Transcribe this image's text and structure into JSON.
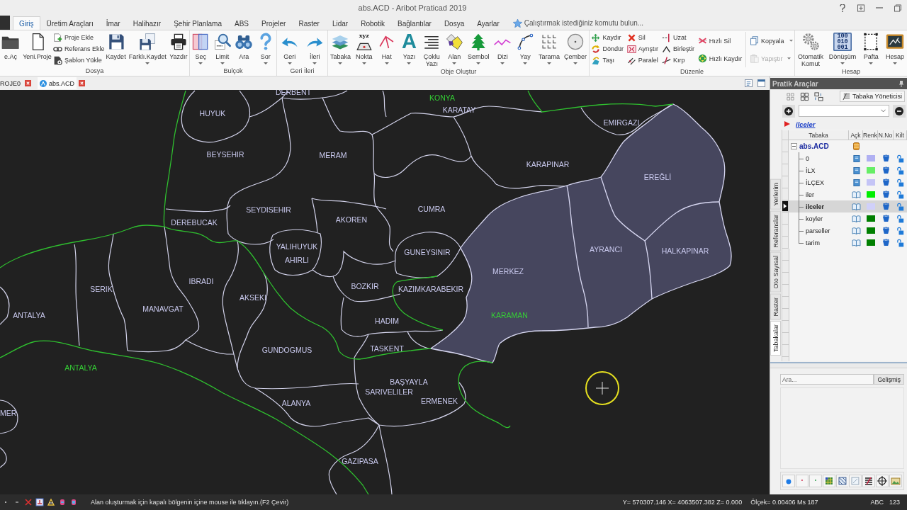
{
  "window": {
    "title": "abs.ACD - Aribot Praticad 2019"
  },
  "menu_tabs": [
    {
      "label": "Giriş",
      "selected": true
    },
    {
      "label": "Üretim Araçları",
      "selected": false
    },
    {
      "label": "İmar",
      "selected": false
    },
    {
      "label": "Halihazır",
      "selected": false
    },
    {
      "label": "Şehir Planlama",
      "selected": false
    },
    {
      "label": "ABS",
      "selected": false
    },
    {
      "label": "Projeler",
      "selected": false
    },
    {
      "label": "Raster",
      "selected": false
    },
    {
      "label": "Lidar",
      "selected": false
    },
    {
      "label": "Robotik",
      "selected": false
    },
    {
      "label": "Bağlantılar",
      "selected": false
    },
    {
      "label": "Dosya",
      "selected": false
    },
    {
      "label": "Ayarlar",
      "selected": false
    }
  ],
  "command_search": {
    "placeholder": "Çalıştırmak istediğiniz komutu bulun..."
  },
  "ribbon": {
    "groups": [
      {
        "label": "Dosya",
        "items": [
          {
            "kind": "large",
            "label": "e.Aç",
            "dropdown": false
          },
          {
            "kind": "large",
            "label": "Yeni.Proje",
            "dropdown": false
          },
          {
            "kind": "stack",
            "entries": [
              {
                "label": "Proje Ekle",
                "dropdown": false,
                "disabled": false
              },
              {
                "label": "Referans Ekle",
                "dropdown": false,
                "disabled": false
              },
              {
                "label": "Şablon Yükle",
                "dropdown": false,
                "disabled": false
              }
            ]
          },
          {
            "kind": "large",
            "label": "Kaydet",
            "dropdown": false
          },
          {
            "kind": "large",
            "label": "Farklı.Kaydet",
            "dropdown": true
          },
          {
            "kind": "large",
            "label": "Yazdır",
            "dropdown": false
          }
        ]
      },
      {
        "label": "Bulçok",
        "items": [
          {
            "kind": "large",
            "label": "Seç",
            "dropdown": true
          },
          {
            "kind": "large",
            "label": "Limit",
            "dropdown": true
          },
          {
            "kind": "large",
            "label": "Ara",
            "dropdown": false
          },
          {
            "kind": "large",
            "label": "Sor",
            "dropdown": true
          }
        ]
      },
      {
        "label": "Geri İleri",
        "items": [
          {
            "kind": "large",
            "label": "Geri",
            "dropdown": true
          },
          {
            "kind": "large",
            "label": "İleri",
            "dropdown": true
          }
        ]
      },
      {
        "label": "Obje Oluştur",
        "items": [
          {
            "kind": "large",
            "label": "Tabaka",
            "dropdown": true
          },
          {
            "kind": "large",
            "label": "Nokta",
            "dropdown": true,
            "icon_text": "xyz"
          },
          {
            "kind": "large",
            "label": "Hat",
            "dropdown": true
          },
          {
            "kind": "large",
            "label": "Yazı",
            "dropdown": true,
            "icon_text": "A"
          },
          {
            "kind": "large",
            "label": "Çoklu Yazı",
            "dropdown": false
          },
          {
            "kind": "large",
            "label": "Alan",
            "dropdown": true
          },
          {
            "kind": "large",
            "label": "Sembol",
            "dropdown": true
          },
          {
            "kind": "large",
            "label": "Dizi",
            "dropdown": true
          },
          {
            "kind": "large",
            "label": "Yay",
            "dropdown": true
          },
          {
            "kind": "large",
            "label": "Tarama",
            "dropdown": true
          },
          {
            "kind": "large",
            "label": "Çember",
            "dropdown": true
          }
        ]
      },
      {
        "label": "Düzenle",
        "items": [
          {
            "kind": "stack",
            "entries": [
              {
                "label": "Kaydır",
                "dropdown": false,
                "disabled": false
              },
              {
                "label": "Döndür",
                "dropdown": false,
                "disabled": false
              },
              {
                "label": "Taşı",
                "dropdown": false,
                "disabled": false
              }
            ]
          },
          {
            "kind": "stack",
            "entries": [
              {
                "label": "Sil",
                "dropdown": false,
                "disabled": false
              },
              {
                "label": "Ayrıştır",
                "dropdown": false,
                "disabled": false
              },
              {
                "label": "Paralel",
                "dropdown": false,
                "disabled": false
              }
            ]
          },
          {
            "kind": "stack",
            "entries": [
              {
                "label": "Uzat",
                "dropdown": false,
                "disabled": false
              },
              {
                "label": "Birleştir",
                "dropdown": false,
                "disabled": false
              },
              {
                "label": "Kırp",
                "dropdown": false,
                "disabled": false
              }
            ]
          },
          {
            "kind": "stack",
            "entries": [
              {
                "label": "Hızlı Sil",
                "dropdown": false,
                "disabled": false
              },
              {
                "label": "Hızlı Kaydır",
                "dropdown": false,
                "disabled": false
              }
            ]
          },
          {
            "kind": "stack",
            "entries": [
              {
                "label": "Kopyala",
                "dropdown": true,
                "disabled": false
              },
              {
                "label": "Yapıştır",
                "dropdown": true,
                "disabled": true
              }
            ]
          }
        ]
      },
      {
        "label": "Hesap",
        "items": [
          {
            "kind": "large",
            "label": "Otomatik Komut",
            "dropdown": false
          },
          {
            "kind": "large",
            "label": "Dönüşüm",
            "dropdown": true,
            "icon_text": "100 010 001"
          },
          {
            "kind": "large",
            "label": "Pafta",
            "dropdown": true
          },
          {
            "kind": "large",
            "label": "Hesap",
            "dropdown": true
          }
        ]
      }
    ]
  },
  "document_tabs": [
    {
      "label": "ROJE0",
      "selected": false
    },
    {
      "label": "abs.ACD",
      "selected": true
    }
  ],
  "map": {
    "labels": [
      {
        "text": "DERBENT",
        "kind": "district"
      },
      {
        "text": "KONYA",
        "kind": "province"
      },
      {
        "text": "KARATAY",
        "kind": "district"
      },
      {
        "text": "HUYUK",
        "kind": "district"
      },
      {
        "text": "EMIRGAZI",
        "kind": "district"
      },
      {
        "text": "BEYSEHIR",
        "kind": "district"
      },
      {
        "text": "MERAM",
        "kind": "district"
      },
      {
        "text": "KARAPINAR",
        "kind": "district"
      },
      {
        "text": "EREĞLİ",
        "kind": "district"
      },
      {
        "text": "SEYDISEHIR",
        "kind": "district"
      },
      {
        "text": "CUMRA",
        "kind": "district"
      },
      {
        "text": "DEREBUCAK",
        "kind": "district"
      },
      {
        "text": "AKOREN",
        "kind": "district"
      },
      {
        "text": "YALIHUYUK",
        "kind": "district"
      },
      {
        "text": "AHIRLI",
        "kind": "district"
      },
      {
        "text": "GUNEYSINIR",
        "kind": "district"
      },
      {
        "text": "AYRANCI",
        "kind": "district"
      },
      {
        "text": "HALKAPINAR",
        "kind": "district"
      },
      {
        "text": "MERKEZ",
        "kind": "district"
      },
      {
        "text": "IBRADI",
        "kind": "district"
      },
      {
        "text": "SERIK",
        "kind": "district"
      },
      {
        "text": "BOZKIR",
        "kind": "district"
      },
      {
        "text": "KAZIMKARABEKIR",
        "kind": "district"
      },
      {
        "text": "AKSEKI",
        "kind": "district"
      },
      {
        "text": "MANAVGAT",
        "kind": "district"
      },
      {
        "text": "ANTALYA",
        "kind": "district"
      },
      {
        "text": "KARAMAN",
        "kind": "province"
      },
      {
        "text": "HADIM",
        "kind": "district"
      },
      {
        "text": "TASKENT",
        "kind": "district"
      },
      {
        "text": "GUNDOGMUS",
        "kind": "district"
      },
      {
        "text": "ANTALYA",
        "kind": "province"
      },
      {
        "text": "BAŞYAYLA",
        "kind": "district"
      },
      {
        "text": "SARIVELILER",
        "kind": "district"
      },
      {
        "text": "ERMENEK",
        "kind": "district"
      },
      {
        "text": "ALANYA",
        "kind": "district"
      },
      {
        "text": "GAZIPASA",
        "kind": "district"
      },
      {
        "text": "MER",
        "kind": "district"
      }
    ]
  },
  "side_panel": {
    "title": "Pratik Araçlar",
    "manager_button": "Tabaka Yöneticisi",
    "current_layer": "ilceler",
    "layer_table": {
      "columns": [
        "Tabaka",
        "Açk",
        "Renk",
        "N.No",
        "Kilt"
      ],
      "root": {
        "name": "abs.ACD",
        "expanded": true,
        "children": [
          {
            "name": "0",
            "open": false,
            "color": "#b0b0f2",
            "locked": false,
            "selected": false
          },
          {
            "name": "İLX",
            "open": false,
            "color": "#66ee66",
            "locked": false,
            "selected": false
          },
          {
            "name": "İLÇEX",
            "open": false,
            "color": "#c4c4f6",
            "locked": false,
            "selected": false
          },
          {
            "name": "iler",
            "open": true,
            "color": "#00ee00",
            "locked": false,
            "selected": false
          },
          {
            "name": "ilceler",
            "open": true,
            "color": "#d0d0fa",
            "locked": false,
            "selected": true
          },
          {
            "name": "koyler",
            "open": true,
            "color": "#007f00",
            "locked": false,
            "selected": false
          },
          {
            "name": "parseller",
            "open": true,
            "color": "#007f00",
            "locked": false,
            "selected": false
          },
          {
            "name": "tarim",
            "open": true,
            "color": "#007f00",
            "locked": false,
            "selected": false
          }
        ]
      }
    },
    "vertical_tabs": [
      {
        "label": "Yerlerim",
        "selected": false
      },
      {
        "label": "Referanslar",
        "selected": false
      },
      {
        "label": "Oto Sayısal",
        "selected": false
      },
      {
        "label": "Raster",
        "selected": false
      },
      {
        "label": "Tabakalar",
        "selected": true
      }
    ],
    "search": {
      "placeholder": "Ara...",
      "button": "Gelişmiş"
    }
  },
  "status_bar": {
    "message": "Alan oluşturmak için kapalı bölgenin içine mouse ile tıklayın.(F2 Çevir)",
    "coordinates": "Y= 570307.146 X= 4063507.382 Z= 0.000",
    "scale": "Ölçek= 0.00406 Ms 187",
    "input_modes": [
      "ABC",
      "123"
    ]
  }
}
